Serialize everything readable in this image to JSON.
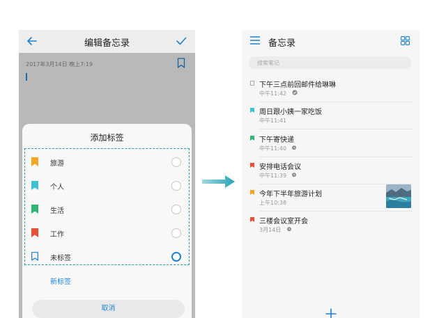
{
  "colors": {
    "blue": "#1b7fd0",
    "teal_arrow": "#2aa3b5",
    "tag_travel": "#f5a623",
    "tag_personal": "#3ec1d3",
    "tag_life": "#2bb673",
    "tag_work": "#e8503a"
  },
  "edit_screen": {
    "back_icon": "arrow-left-icon",
    "title": "编辑备忘录",
    "confirm_icon": "check-icon",
    "date_text": "2017年3月14日 晚上7:19",
    "bookmark_icon": "bookmark-icon",
    "add_tag_sheet": {
      "title": "添加标签",
      "tags": [
        {
          "label": "旅游",
          "color": "#f5a623",
          "selected": false
        },
        {
          "label": "个人",
          "color": "#3ec1d3",
          "selected": false
        },
        {
          "label": "生活",
          "color": "#2bb673",
          "selected": false
        },
        {
          "label": "工作",
          "color": "#e8503a",
          "selected": false
        },
        {
          "label": "未标签",
          "color": "#1b7fd0",
          "selected": true
        }
      ],
      "new_tag": "新标签",
      "cancel": "取消"
    }
  },
  "list_screen": {
    "menu_icon": "menu-icon",
    "title": "备忘录",
    "grid_icon": "grid-view-icon",
    "search_placeholder": "搜索笔记",
    "notes": [
      {
        "title": "下午三点前回邮件给琳琳",
        "time": "中午11:42",
        "marker": "checkbox",
        "marker_color": "#aaaaaa",
        "mark": "done"
      },
      {
        "title": "周日跟小姨一家吃饭",
        "time": "中午11:41",
        "marker": "tag",
        "marker_color": "#3ec1d3",
        "mark": ""
      },
      {
        "title": "下午寄快递",
        "time": "中午11:40",
        "marker": "tag",
        "marker_color": "#2bb673",
        "mark": "alarm"
      },
      {
        "title": "安排电话会议",
        "time": "中午11:39",
        "marker": "tag",
        "marker_color": "#e8503a",
        "mark": "alarm"
      },
      {
        "title": "今年下半年旅游计划",
        "time": "上午10:38",
        "marker": "tag",
        "marker_color": "#f5a623",
        "mark": ""
      },
      {
        "title": "三楼会议室开会",
        "time": "3月14日",
        "marker": "tag",
        "marker_color": "#e8503a",
        "mark": "alarm"
      }
    ],
    "add_icon": "plus-icon"
  }
}
